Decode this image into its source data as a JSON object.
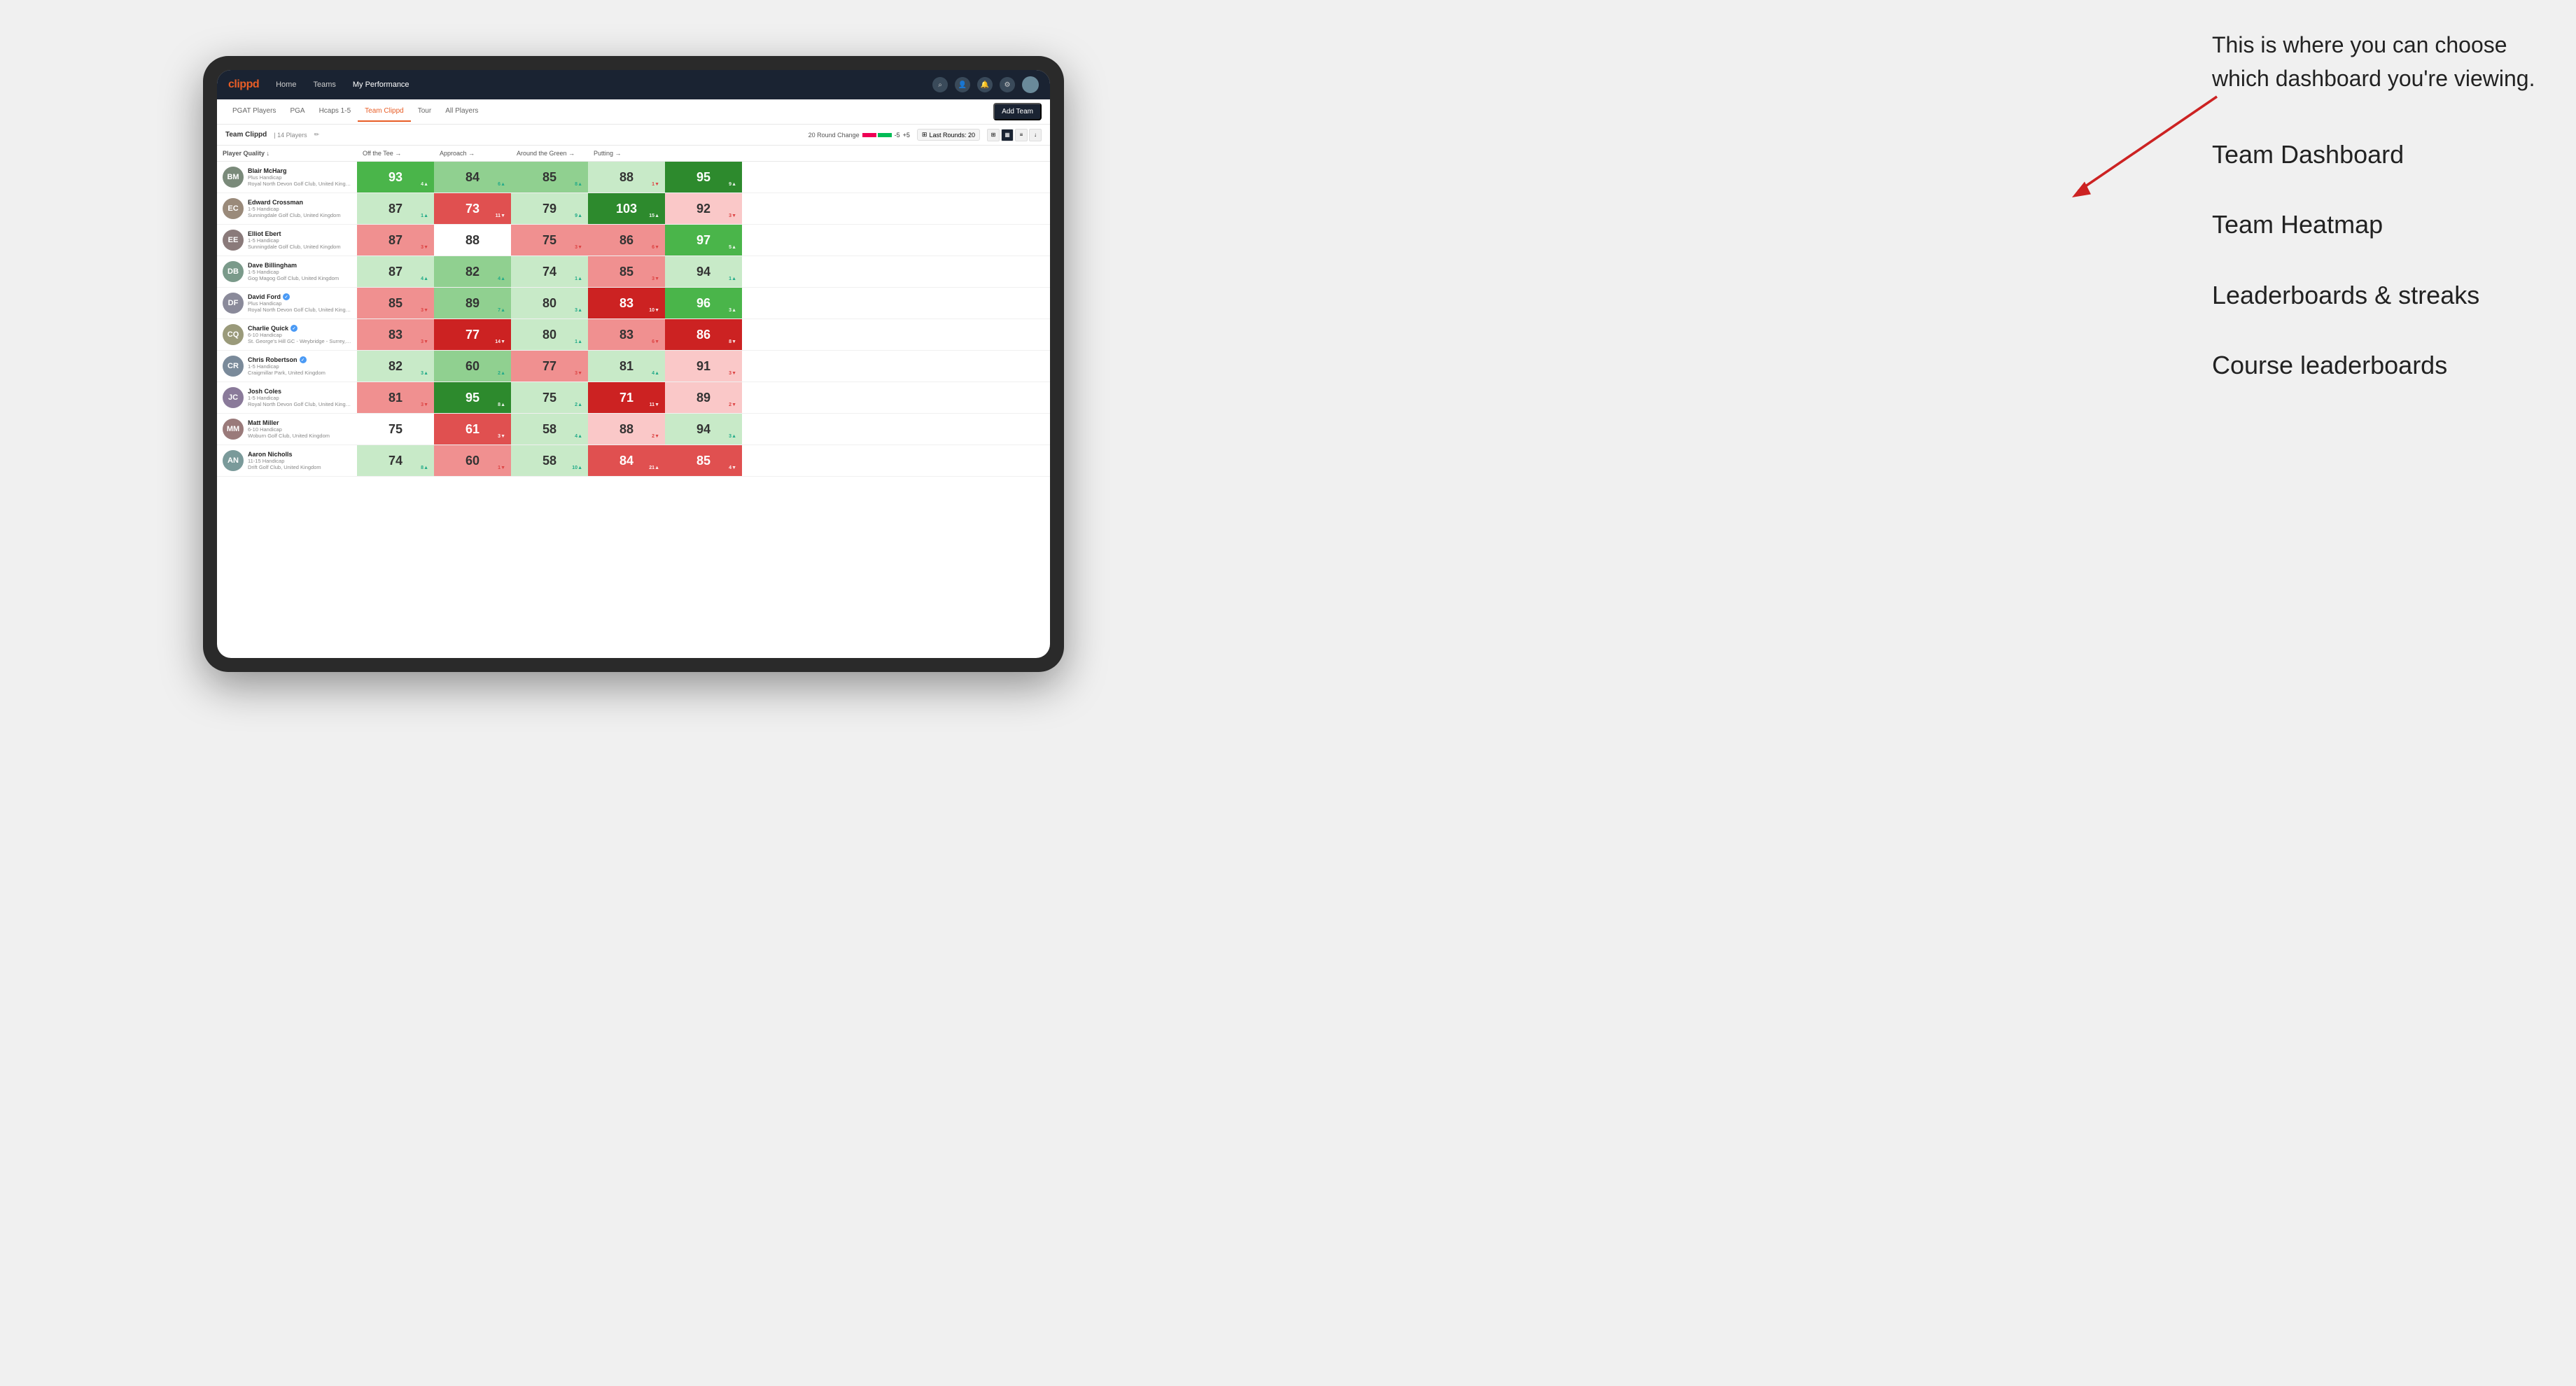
{
  "annotation": {
    "intro": "This is where you can choose which dashboard you're viewing.",
    "items": [
      "Team Dashboard",
      "Team Heatmap",
      "Leaderboards & streaks",
      "Course leaderboards"
    ]
  },
  "navbar": {
    "logo": "clippd",
    "links": [
      "Home",
      "Teams",
      "My Performance"
    ],
    "active_link": "My Performance"
  },
  "subnav": {
    "tabs": [
      "PGAT Players",
      "PGA",
      "Hcaps 1-5",
      "Team Clippd",
      "Tour",
      "All Players"
    ],
    "active_tab": "Team Clippd",
    "add_team_label": "Add Team"
  },
  "team_header": {
    "name": "Team Clippd",
    "separator": "|",
    "count": "14 Players",
    "round_change_label": "20 Round Change",
    "change_neg": "-5",
    "change_pos": "+5",
    "last_rounds_label": "Last Rounds:",
    "last_rounds_value": "20"
  },
  "table": {
    "columns": [
      "Player Quality ↓",
      "Off the Tee →",
      "Approach →",
      "Around the Green →",
      "Putting →"
    ],
    "players": [
      {
        "name": "Blair McHarg",
        "handicap": "Plus Handicap",
        "club": "Royal North Devon Golf Club, United Kingdom",
        "initials": "BM",
        "avatar_color": "#7a8a7a",
        "stats": [
          {
            "value": "93",
            "change": "4",
            "dir": "up",
            "color": "green-mid"
          },
          {
            "value": "84",
            "change": "6",
            "dir": "up",
            "color": "green-light"
          },
          {
            "value": "85",
            "change": "8",
            "dir": "up",
            "color": "green-light"
          },
          {
            "value": "88",
            "change": "1",
            "dir": "down",
            "color": "green-pale"
          },
          {
            "value": "95",
            "change": "9",
            "dir": "up",
            "color": "green-dark"
          }
        ]
      },
      {
        "name": "Edward Crossman",
        "handicap": "1-5 Handicap",
        "club": "Sunningdale Golf Club, United Kingdom",
        "initials": "EC",
        "avatar_color": "#9a8a7a",
        "stats": [
          {
            "value": "87",
            "change": "1",
            "dir": "up",
            "color": "green-pale"
          },
          {
            "value": "73",
            "change": "11",
            "dir": "down",
            "color": "red-mid"
          },
          {
            "value": "79",
            "change": "9",
            "dir": "up",
            "color": "green-pale"
          },
          {
            "value": "103",
            "change": "15",
            "dir": "up",
            "color": "green-dark"
          },
          {
            "value": "92",
            "change": "3",
            "dir": "down",
            "color": "red-pale"
          }
        ]
      },
      {
        "name": "Elliot Ebert",
        "handicap": "1-5 Handicap",
        "club": "Sunningdale Golf Club, United Kingdom",
        "initials": "EE",
        "avatar_color": "#8a7a7a",
        "stats": [
          {
            "value": "87",
            "change": "3",
            "dir": "down",
            "color": "red-light"
          },
          {
            "value": "88",
            "change": "",
            "dir": "",
            "color": "neutral"
          },
          {
            "value": "75",
            "change": "3",
            "dir": "down",
            "color": "red-light"
          },
          {
            "value": "86",
            "change": "6",
            "dir": "down",
            "color": "red-light"
          },
          {
            "value": "97",
            "change": "5",
            "dir": "up",
            "color": "green-mid"
          }
        ]
      },
      {
        "name": "Dave Billingham",
        "handicap": "1-5 Handicap",
        "club": "Gog Magog Golf Club, United Kingdom",
        "initials": "DB",
        "avatar_color": "#7a9a8a",
        "stats": [
          {
            "value": "87",
            "change": "4",
            "dir": "up",
            "color": "green-pale"
          },
          {
            "value": "82",
            "change": "4",
            "dir": "up",
            "color": "green-light"
          },
          {
            "value": "74",
            "change": "1",
            "dir": "up",
            "color": "green-pale"
          },
          {
            "value": "85",
            "change": "3",
            "dir": "down",
            "color": "red-light"
          },
          {
            "value": "94",
            "change": "1",
            "dir": "up",
            "color": "green-pale"
          }
        ]
      },
      {
        "name": "David Ford",
        "handicap": "Plus Handicap",
        "club": "Royal North Devon Golf Club, United Kingdom",
        "initials": "DF",
        "avatar_color": "#8a8a9a",
        "verified": true,
        "stats": [
          {
            "value": "85",
            "change": "3",
            "dir": "down",
            "color": "red-light"
          },
          {
            "value": "89",
            "change": "7",
            "dir": "up",
            "color": "green-light"
          },
          {
            "value": "80",
            "change": "3",
            "dir": "up",
            "color": "green-pale"
          },
          {
            "value": "83",
            "change": "10",
            "dir": "down",
            "color": "red-dark"
          },
          {
            "value": "96",
            "change": "3",
            "dir": "up",
            "color": "green-mid"
          }
        ]
      },
      {
        "name": "Charlie Quick",
        "handicap": "6-10 Handicap",
        "club": "St. George's Hill GC - Weybridge - Surrey, Uni...",
        "initials": "CQ",
        "avatar_color": "#9a9a7a",
        "verified": true,
        "stats": [
          {
            "value": "83",
            "change": "3",
            "dir": "down",
            "color": "red-light"
          },
          {
            "value": "77",
            "change": "14",
            "dir": "down",
            "color": "red-dark"
          },
          {
            "value": "80",
            "change": "1",
            "dir": "up",
            "color": "green-pale"
          },
          {
            "value": "83",
            "change": "6",
            "dir": "down",
            "color": "red-light"
          },
          {
            "value": "86",
            "change": "8",
            "dir": "down",
            "color": "red-dark"
          }
        ]
      },
      {
        "name": "Chris Robertson",
        "handicap": "1-5 Handicap",
        "club": "Craigmillar Park, United Kingdom",
        "initials": "CR",
        "avatar_color": "#7a8a9a",
        "verified": true,
        "stats": [
          {
            "value": "82",
            "change": "3",
            "dir": "up",
            "color": "green-pale"
          },
          {
            "value": "60",
            "change": "2",
            "dir": "up",
            "color": "green-light"
          },
          {
            "value": "77",
            "change": "3",
            "dir": "down",
            "color": "red-light"
          },
          {
            "value": "81",
            "change": "4",
            "dir": "up",
            "color": "green-pale"
          },
          {
            "value": "91",
            "change": "3",
            "dir": "down",
            "color": "red-pale"
          }
        ]
      },
      {
        "name": "Josh Coles",
        "handicap": "1-5 Handicap",
        "club": "Royal North Devon Golf Club, United Kingdom",
        "initials": "JC",
        "avatar_color": "#8a7a9a",
        "stats": [
          {
            "value": "81",
            "change": "3",
            "dir": "down",
            "color": "red-light"
          },
          {
            "value": "95",
            "change": "8",
            "dir": "up",
            "color": "green-dark"
          },
          {
            "value": "75",
            "change": "2",
            "dir": "up",
            "color": "green-pale"
          },
          {
            "value": "71",
            "change": "11",
            "dir": "down",
            "color": "red-dark"
          },
          {
            "value": "89",
            "change": "2",
            "dir": "down",
            "color": "red-pale"
          }
        ]
      },
      {
        "name": "Matt Miller",
        "handicap": "6-10 Handicap",
        "club": "Woburn Golf Club, United Kingdom",
        "initials": "MM",
        "avatar_color": "#9a7a7a",
        "stats": [
          {
            "value": "75",
            "change": "",
            "dir": "",
            "color": "neutral"
          },
          {
            "value": "61",
            "change": "3",
            "dir": "down",
            "color": "red-mid"
          },
          {
            "value": "58",
            "change": "4",
            "dir": "up",
            "color": "green-pale"
          },
          {
            "value": "88",
            "change": "2",
            "dir": "down",
            "color": "red-pale"
          },
          {
            "value": "94",
            "change": "3",
            "dir": "up",
            "color": "green-pale"
          }
        ]
      },
      {
        "name": "Aaron Nicholls",
        "handicap": "11-15 Handicap",
        "club": "Drift Golf Club, United Kingdom",
        "initials": "AN",
        "avatar_color": "#7a9a9a",
        "stats": [
          {
            "value": "74",
            "change": "8",
            "dir": "up",
            "color": "green-pale"
          },
          {
            "value": "60",
            "change": "1",
            "dir": "down",
            "color": "red-light"
          },
          {
            "value": "58",
            "change": "10",
            "dir": "up",
            "color": "green-pale"
          },
          {
            "value": "84",
            "change": "21",
            "dir": "up",
            "color": "red-mid"
          },
          {
            "value": "85",
            "change": "4",
            "dir": "down",
            "color": "red-mid"
          }
        ]
      }
    ]
  }
}
